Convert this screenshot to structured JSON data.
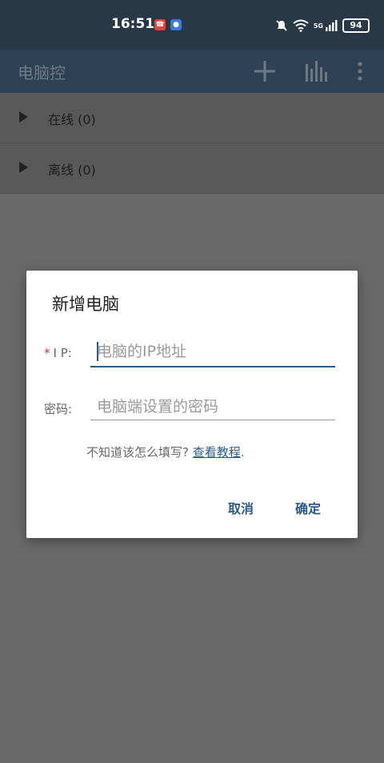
{
  "status_bar": {
    "time": "16:51",
    "battery": "94",
    "network": "5G"
  },
  "app_bar": {
    "title": "电脑控"
  },
  "groups": [
    {
      "label": "在线 (0)"
    },
    {
      "label": "离线 (0)"
    }
  ],
  "dialog": {
    "title": "新增电脑",
    "ip_field": {
      "required_mark": "*",
      "label": "I P:",
      "placeholder": "电脑的IP地址",
      "value": ""
    },
    "password_field": {
      "label": "密码:",
      "placeholder": "电脑端设置的密码",
      "value": ""
    },
    "hint_text": "不知道该怎么填写? ",
    "hint_link": "查看教程",
    "hint_suffix": ".",
    "cancel_label": "取消",
    "confirm_label": "确定"
  },
  "colors": {
    "app_bar": "#2e4256",
    "status_bar": "#283846",
    "accent": "#2d5b86",
    "required": "#d33333"
  }
}
